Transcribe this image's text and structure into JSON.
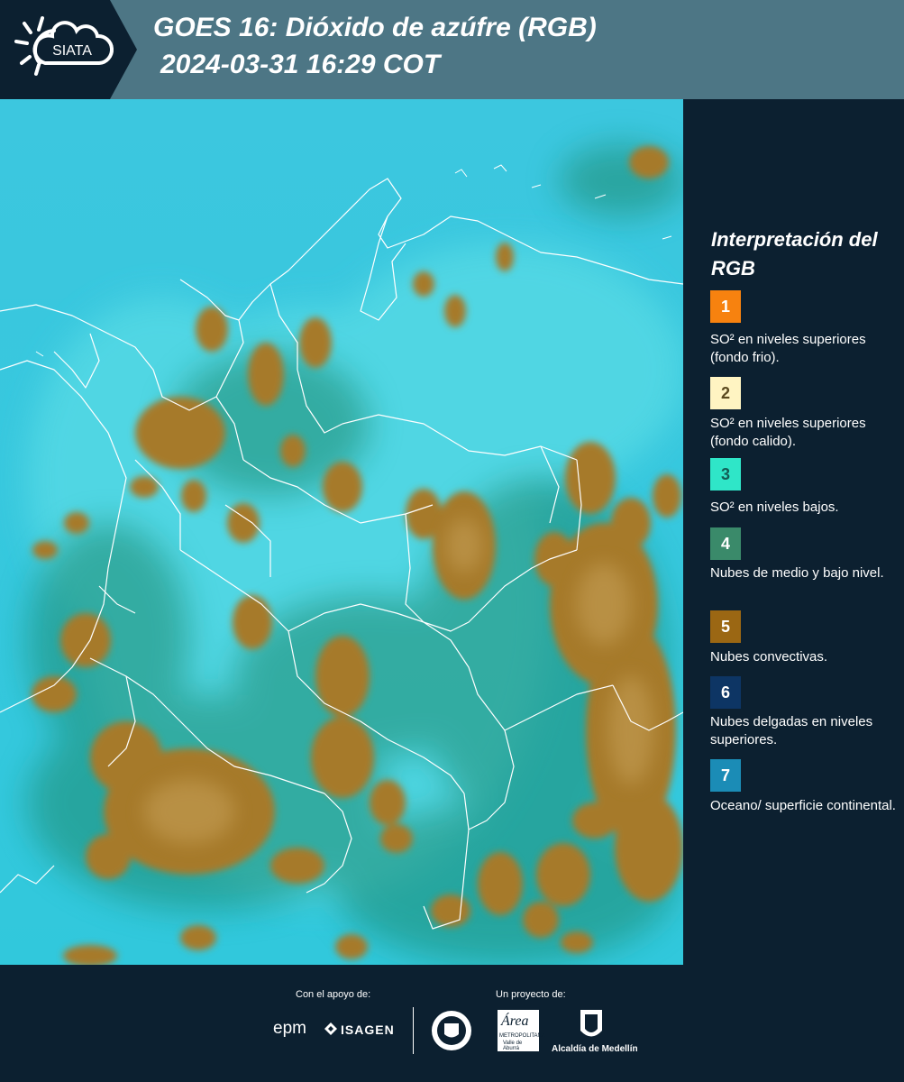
{
  "header": {
    "logo_text": "SIATA",
    "title_line1": "GOES 16: Dióxido de azúfre (RGB)",
    "title_line2": "2024-03-31 16:29 COT",
    "bg_color": "#4d7685",
    "logo_bg_color": "#0c2030"
  },
  "legend": {
    "title": "Interpretación del RGB",
    "items": [
      {
        "number": "1",
        "color": "#f7820f",
        "text": "SO² en niveles superiores (fondo frio)."
      },
      {
        "number": "2",
        "color": "#fff4c2",
        "text": "SO² en niveles superiores (fondo calido)."
      },
      {
        "number": "3",
        "color": "#2fe6c8",
        "text": "SO² en niveles bajos."
      },
      {
        "number": "4",
        "color": "#3a8a6a",
        "text": "Nubes de medio y bajo nivel."
      },
      {
        "number": "5",
        "color": "#9b6713",
        "text": "Nubes convectivas."
      },
      {
        "number": "6",
        "color": "#0d3564",
        "text": "Nubes delgadas en niveles superiores."
      },
      {
        "number": "7",
        "color": "#1b8cb6",
        "text": "Oceano/ superficie continental."
      }
    ]
  },
  "footer": {
    "support_label": "Con el apoyo de:",
    "project_label": "Un proyecto de:",
    "sponsor1": "epm",
    "sponsor2": "ISAGEN",
    "partner1": "Área",
    "partner1_sub": "METROPOLITANA",
    "partner1_sub2": "Valle de Aburrá",
    "partner2": "Alcaldía de Medellín"
  }
}
